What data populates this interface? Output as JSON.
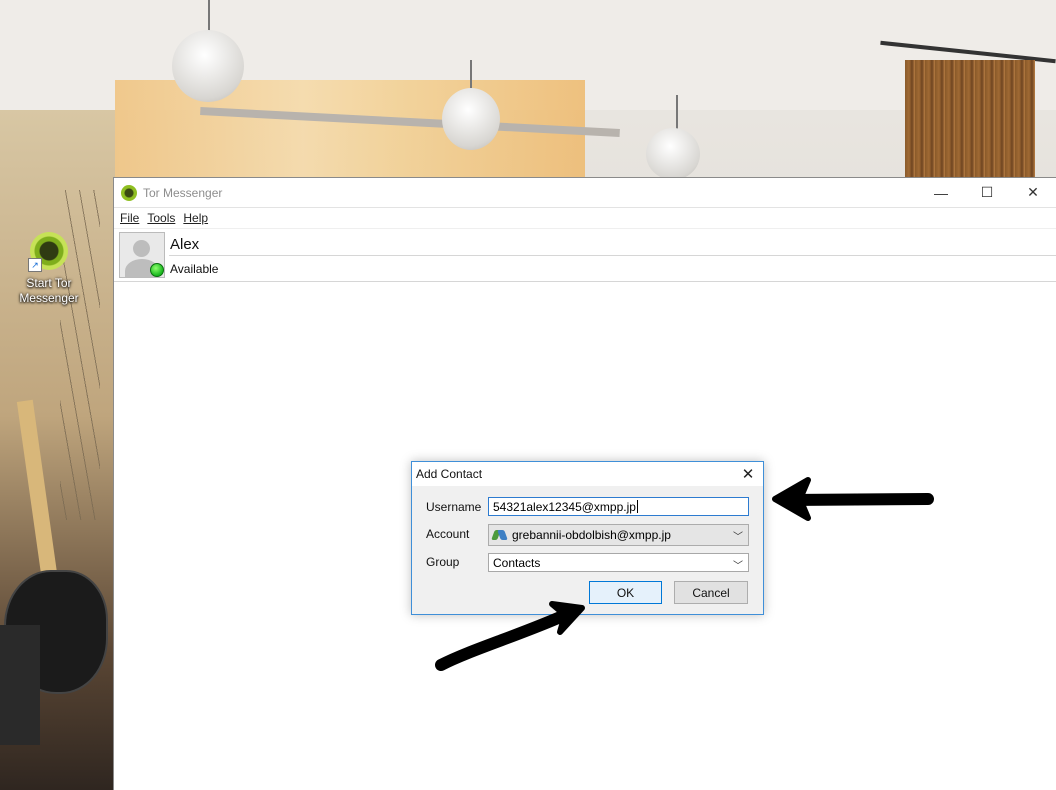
{
  "desktop": {
    "icon_label_line1": "Start Tor",
    "icon_label_line2": "Messenger"
  },
  "window": {
    "title": "Tor Messenger",
    "controls": {
      "minimize": "—",
      "maximize": "☐",
      "close": "✕"
    }
  },
  "menu": {
    "file": "File",
    "tools": "Tools",
    "help": "Help"
  },
  "profile": {
    "name": "Alex",
    "status": "Available"
  },
  "dialog": {
    "title": "Add Contact",
    "username_label": "Username",
    "username_value": "54321alex12345@xmpp.jp",
    "account_label": "Account",
    "account_value": "grebannii-obdolbish@xmpp.jp",
    "group_label": "Group",
    "group_value": "Contacts",
    "ok": "OK",
    "cancel": "Cancel"
  },
  "colors": {
    "dialog_border": "#3f8fd8",
    "presence_available": "#17b61d",
    "arrow": "#000000"
  }
}
